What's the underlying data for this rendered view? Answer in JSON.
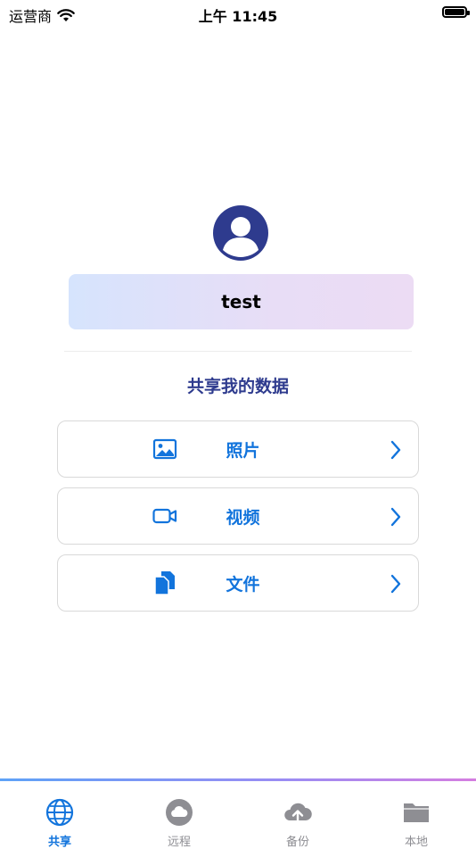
{
  "status_bar": {
    "carrier": "运营商",
    "time": "上午 11:45"
  },
  "profile": {
    "username": "test"
  },
  "section": {
    "title": "共享我的数据"
  },
  "menu": [
    {
      "label": "照片",
      "icon": "photo-icon"
    },
    {
      "label": "视频",
      "icon": "video-icon"
    },
    {
      "label": "文件",
      "icon": "file-icon"
    }
  ],
  "tabs": [
    {
      "label": "共享",
      "icon": "globe-icon",
      "active": true
    },
    {
      "label": "远程",
      "icon": "cloud-icon",
      "active": false
    },
    {
      "label": "备份",
      "icon": "cloud-upload-icon",
      "active": false
    },
    {
      "label": "本地",
      "icon": "folder-icon",
      "active": false
    }
  ],
  "colors": {
    "accent": "#1274dc",
    "title": "#2e3b8e",
    "avatar": "#2e3b8e",
    "tab_inactive": "#8e8e93"
  }
}
